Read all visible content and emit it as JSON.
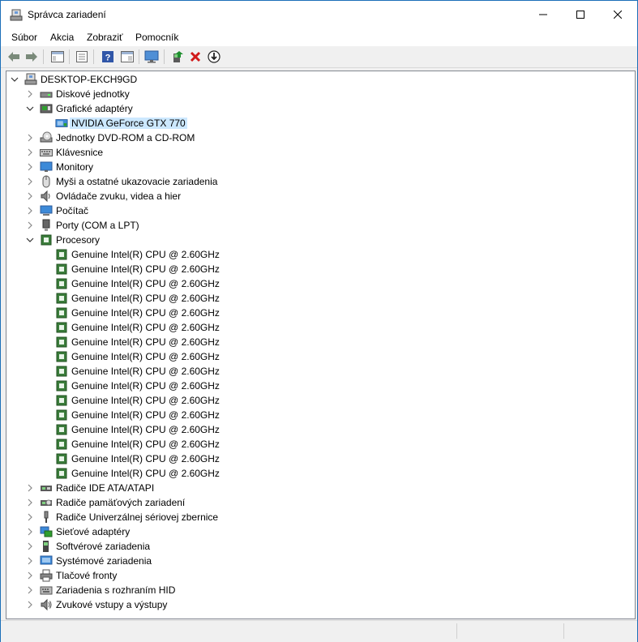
{
  "window": {
    "title": "Správca zariadení"
  },
  "titlebar_buttons": [
    "minimize",
    "maximize",
    "close"
  ],
  "menu": [
    "Súbor",
    "Akcia",
    "Zobraziť",
    "Pomocník"
  ],
  "toolbar_icons": [
    "back-arrow-icon",
    "forward-arrow-icon",
    "show-hide-tree-icon",
    "properties-icon",
    "help-icon",
    "view-icon",
    "monitor-icon",
    "update-driver-icon",
    "uninstall-icon",
    "disable-device-icon"
  ],
  "tree": {
    "root": "DESKTOP-EKCH9GD",
    "categories": [
      {
        "label": "Diskové jednotky",
        "icon": "disk-drive-icon",
        "expanded": false
      },
      {
        "label": "Grafické adaptéry",
        "icon": "display-adapter-icon",
        "expanded": true,
        "children": [
          "NVIDIA GeForce GTX 770"
        ]
      },
      {
        "label": "Jednotky DVD-ROM a CD-ROM",
        "icon": "dvd-icon",
        "expanded": false
      },
      {
        "label": "Klávesnice",
        "icon": "keyboard-icon",
        "expanded": false
      },
      {
        "label": "Monitory",
        "icon": "monitor-icon",
        "expanded": false
      },
      {
        "label": "Myši a ostatné ukazovacie zariadenia",
        "icon": "mouse-icon",
        "expanded": false
      },
      {
        "label": "Ovládače zvuku, videa a hier",
        "icon": "sound-icon",
        "expanded": false
      },
      {
        "label": "Počítač",
        "icon": "computer-icon",
        "expanded": false
      },
      {
        "label": "Porty (COM a LPT)",
        "icon": "port-icon",
        "expanded": false
      },
      {
        "label": "Procesory",
        "icon": "processor-icon",
        "expanded": true,
        "children": [
          "Genuine Intel(R) CPU  @ 2.60GHz",
          "Genuine Intel(R) CPU  @ 2.60GHz",
          "Genuine Intel(R) CPU  @ 2.60GHz",
          "Genuine Intel(R) CPU  @ 2.60GHz",
          "Genuine Intel(R) CPU  @ 2.60GHz",
          "Genuine Intel(R) CPU  @ 2.60GHz",
          "Genuine Intel(R) CPU  @ 2.60GHz",
          "Genuine Intel(R) CPU  @ 2.60GHz",
          "Genuine Intel(R) CPU  @ 2.60GHz",
          "Genuine Intel(R) CPU  @ 2.60GHz",
          "Genuine Intel(R) CPU  @ 2.60GHz",
          "Genuine Intel(R) CPU  @ 2.60GHz",
          "Genuine Intel(R) CPU  @ 2.60GHz",
          "Genuine Intel(R) CPU  @ 2.60GHz",
          "Genuine Intel(R) CPU  @ 2.60GHz",
          "Genuine Intel(R) CPU  @ 2.60GHz"
        ]
      },
      {
        "label": "Radiče IDE ATA/ATAPI",
        "icon": "ide-controller-icon",
        "expanded": false
      },
      {
        "label": "Radiče pamäťových zariadení",
        "icon": "storage-controller-icon",
        "expanded": false
      },
      {
        "label": "Radiče Univerzálnej sériovej zbernice",
        "icon": "usb-icon",
        "expanded": false
      },
      {
        "label": "Sieťové adaptéry",
        "icon": "network-adapter-icon",
        "expanded": false
      },
      {
        "label": "Softvérové zariadenia",
        "icon": "software-device-icon",
        "expanded": false
      },
      {
        "label": "Systémové zariadenia",
        "icon": "system-device-icon",
        "expanded": false
      },
      {
        "label": "Tlačové fronty",
        "icon": "printer-icon",
        "expanded": false
      },
      {
        "label": "Zariadenia s rozhraním HID",
        "icon": "hid-icon",
        "expanded": false
      },
      {
        "label": "Zvukové vstupy a výstupy",
        "icon": "audio-io-icon",
        "expanded": false
      }
    ]
  },
  "selected_item": "NVIDIA GeForce GTX 770",
  "colors": {
    "selection": "#cce8ff",
    "border": "#1c6fb8",
    "uninstall_red": "#d11a1a",
    "cpu_green": "#3b7d3b"
  }
}
